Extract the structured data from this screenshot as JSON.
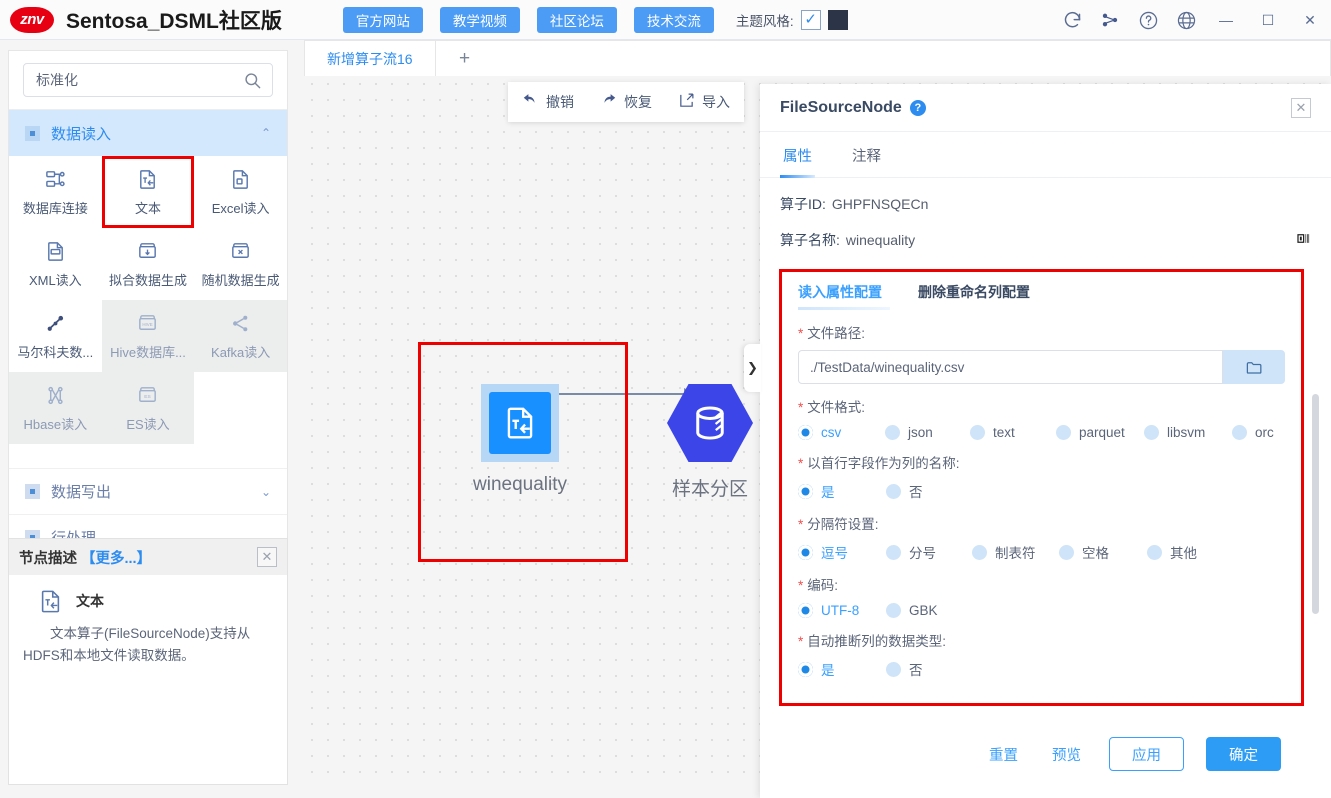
{
  "app": {
    "logo_text": "znv",
    "title": "Sentosa_DSML社区版"
  },
  "topnav": {
    "buttons": [
      {
        "label": "官方网站",
        "name": "official-site-button"
      },
      {
        "label": "教学视频",
        "name": "tutorial-video-button"
      },
      {
        "label": "社区论坛",
        "name": "community-forum-button"
      },
      {
        "label": "技术交流",
        "name": "tech-exchange-button"
      }
    ],
    "theme_label": "主题风格:",
    "theme_checked": "✓",
    "theme_swatch_color": "#2c3548"
  },
  "window_controls": {
    "minimize": "—",
    "maximize": "☐",
    "close": "✕"
  },
  "sidebar": {
    "search": {
      "value": "标准化",
      "placeholder": "标准化"
    },
    "categories": [
      {
        "label": "数据读入",
        "expanded": true,
        "chevron": "⌃"
      },
      {
        "label": "数据写出",
        "expanded": false,
        "chevron": "⌄"
      },
      {
        "label": "行处理",
        "expanded": false,
        "chevron": "⌄"
      }
    ],
    "operators": [
      {
        "label": "数据库连接",
        "icon": "database-connect-icon",
        "state": "normal"
      },
      {
        "label": "文本",
        "icon": "text-file-icon",
        "state": "selected"
      },
      {
        "label": "Excel读入",
        "icon": "excel-file-icon",
        "state": "normal"
      },
      {
        "label": "XML读入",
        "icon": "xml-file-icon",
        "state": "normal"
      },
      {
        "label": "拟合数据生成",
        "icon": "fit-data-icon",
        "state": "normal"
      },
      {
        "label": "随机数据生成",
        "icon": "random-data-icon",
        "state": "normal"
      },
      {
        "label": "马尔科夫数...",
        "icon": "markov-icon",
        "state": "normal"
      },
      {
        "label": "Hive数据库...",
        "icon": "hive-icon",
        "state": "disabled"
      },
      {
        "label": "Kafka读入",
        "icon": "kafka-icon",
        "state": "disabled"
      },
      {
        "label": "Hbase读入",
        "icon": "hbase-icon",
        "state": "disabled"
      },
      {
        "label": "ES读入",
        "icon": "es-icon",
        "state": "disabled"
      }
    ],
    "description": {
      "header": "节点描述",
      "more": "【更多...】",
      "close": "✕",
      "node_title": "文本",
      "text": "文本算子(FileSourceNode)支持从HDFS和本地文件读取数据。"
    }
  },
  "canvas": {
    "tab_label": "新增算子流16",
    "add_tab": "+",
    "toolbar": [
      {
        "label": "撤销",
        "icon": "undo-icon"
      },
      {
        "label": "恢复",
        "icon": "redo-icon"
      },
      {
        "label": "导入",
        "icon": "import-icon"
      }
    ],
    "nodes": [
      {
        "label": "winequality",
        "icon": "text-file-icon",
        "selected": true
      },
      {
        "label": "样本分区",
        "icon": "partition-icon",
        "selected": false
      }
    ]
  },
  "panel": {
    "title": "FileSourceNode",
    "help": "?",
    "close": "✕",
    "handle": "❯",
    "tabs": [
      {
        "label": "属性",
        "active": true
      },
      {
        "label": "注释",
        "active": false
      }
    ],
    "operator_id_label": "算子ID:",
    "operator_id_value": "GHPFNSQECn",
    "operator_name_label": "算子名称:",
    "operator_name_value": "winequality",
    "config": {
      "sub_tabs": [
        {
          "label": "读入属性配置",
          "active": true
        },
        {
          "label": "删除重命名列配置",
          "active": false
        }
      ],
      "fields": [
        {
          "label": "文件路径:",
          "required": true,
          "type": "path",
          "value": "./TestData/winequality.csv",
          "browse_icon": "folder-icon"
        },
        {
          "label": "文件格式:",
          "required": true,
          "type": "radio",
          "options": [
            "csv",
            "json",
            "text",
            "parquet",
            "libsvm",
            "orc"
          ],
          "selected": "csv"
        },
        {
          "label": "以首行字段作为列的名称:",
          "required": true,
          "type": "radio",
          "options": [
            "是",
            "否"
          ],
          "selected": "是"
        },
        {
          "label": "分隔符设置:",
          "required": true,
          "type": "radio",
          "options": [
            "逗号",
            "分号",
            "制表符",
            "空格",
            "其他"
          ],
          "selected": "逗号"
        },
        {
          "label": "编码:",
          "required": true,
          "type": "radio",
          "options": [
            "UTF-8",
            "GBK"
          ],
          "selected": "UTF-8"
        },
        {
          "label": "自动推断列的数据类型:",
          "required": true,
          "type": "radio",
          "options": [
            "是",
            "否"
          ],
          "selected": "是"
        }
      ]
    },
    "footer": {
      "reset": "重置",
      "preview": "预览",
      "apply": "应用",
      "confirm": "确定"
    }
  },
  "colors": {
    "accent": "#2d8cf0",
    "highlight": "#ee0000",
    "node_blue": "#1890ff",
    "hex_blue": "#3c46e8"
  }
}
